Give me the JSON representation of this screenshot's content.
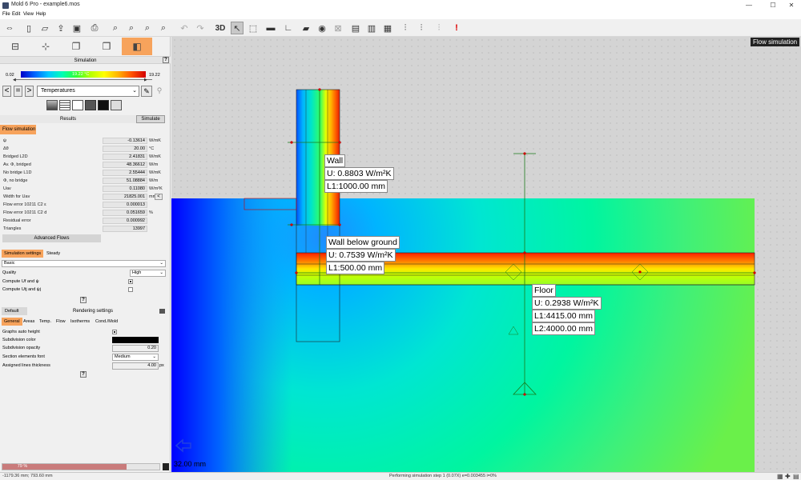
{
  "window": {
    "title": "Mold 6 Pro - example6.mos",
    "minimize": "—",
    "maximize": "☐",
    "close": "✕"
  },
  "menu": [
    "File",
    "Edit",
    "View",
    "Help"
  ],
  "toolbar": {
    "three_d_label": "3D"
  },
  "left_panel": {
    "simulation_header": "Simulation",
    "help": "?",
    "scale": {
      "min": "0.02",
      "mid": "19.22 °C",
      "max": "19.22"
    },
    "view_selector": {
      "prev": "<",
      "equals": "=",
      "next": ">",
      "selected": "Temperatures"
    },
    "tabs": {
      "results": "Results",
      "simulate": "Simulate"
    },
    "flow_tab": "Flow simulation",
    "results_rows": [
      {
        "label": "ψ",
        "value": "-0.13614",
        "unit": "W/mK"
      },
      {
        "label": "Δθ",
        "value": "20.00",
        "unit": "°C"
      },
      {
        "label": "Bridged L2D",
        "value": "2.41831",
        "unit": "W/mK"
      },
      {
        "label": "Av. Φ, bridged",
        "value": "48.36612",
        "unit": "W/m"
      },
      {
        "label": "No bridge L1D",
        "value": "2.55444",
        "unit": "W/mK"
      },
      {
        "label": "Φ, no bridge",
        "value": "51.08884",
        "unit": "W/m"
      },
      {
        "label": "Uav",
        "value": "0.11080",
        "unit": "W/m²K"
      },
      {
        "label": "Width for Uav",
        "value": "21825.001",
        "unit": "mm"
      },
      {
        "label": "Flow error 10211 C2 ε",
        "value": "0.000013",
        "unit": ""
      },
      {
        "label": "Flow error 10211 C2 d",
        "value": "0.051659",
        "unit": "%"
      },
      {
        "label": "Residual error",
        "value": "0.000992",
        "unit": ""
      },
      {
        "label": "Triangles",
        "value": "13997",
        "unit": ""
      }
    ],
    "advanced_flows": "Advanced Flows",
    "sim_tabs": [
      "Simulation settings",
      "Steady"
    ],
    "sim_mode": "Basic",
    "quality_label": "Quality",
    "quality_value": "High",
    "compute_uf": "Compute Uf and ψ",
    "compute_utj": "Compute Utj and ψj",
    "render_tabs": {
      "default": "Default",
      "rendering": "Rendering settings"
    },
    "render_subtabs": [
      "General",
      "Areas",
      "Temp.",
      "Flow",
      "Isotherms",
      "Cond./Mold"
    ],
    "render_rows": {
      "graphs_auto_height": "Graphs auto height",
      "subdivision_color": "Subdivision color",
      "subdivision_opacity": "Subdivision opacity",
      "subdivision_opacity_value": "0.20",
      "section_font": "Section elements font",
      "section_font_value": "Medium",
      "assigned_lines": "Assigned lines thickness",
      "assigned_lines_value": "4.00",
      "assigned_lines_unit": "px"
    },
    "progress": {
      "text": "79 %",
      "fraction": 0.79
    }
  },
  "canvas": {
    "mode_label": "Flow simulation",
    "labels": [
      {
        "title": "Wall",
        "u": "U: 0.8803 W/m²K",
        "l1": "L1:1000.00 mm"
      },
      {
        "title": "Wall below ground",
        "u": "U: 0.7539 W/m²K",
        "l1": "L1:500.00 mm"
      },
      {
        "title": "Floor",
        "u": "U: 0.2938 W/m²K",
        "l1": "L1:4415.00 mm",
        "l2": "L2:4000.00 mm"
      }
    ],
    "scale_bar": "32.00 mm"
  },
  "status": {
    "coords": "-1179.36 mm; 793.60 mm",
    "message": "Performing simulation step 1 (0.07X) e=0.003455 i=0%"
  }
}
